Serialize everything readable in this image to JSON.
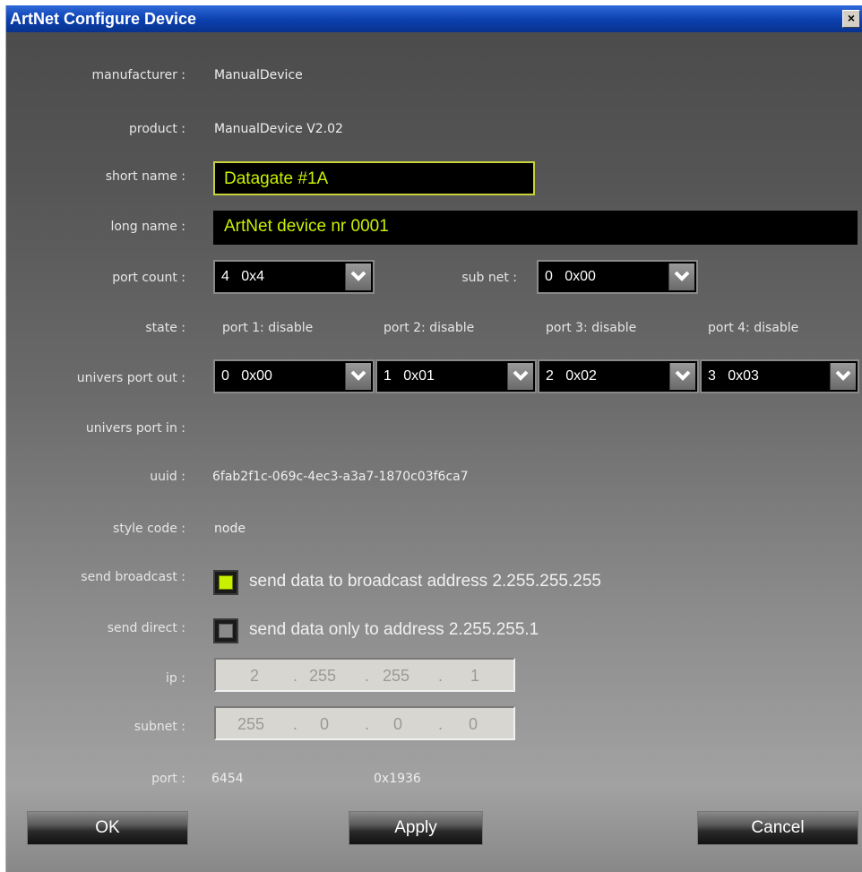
{
  "window": {
    "title": "ArtNet Configure Device",
    "close_label": "×"
  },
  "labels": {
    "manufacturer": "manufacturer :",
    "product": "product :",
    "short_name": "short name :",
    "long_name": "long name :",
    "port_count": "port count :",
    "sub_net": "sub net :",
    "state": "state :",
    "univers_port_out": "univers port out :",
    "univers_port_in": "univers port in :",
    "uuid": "uuid :",
    "style_code": "style code :",
    "send_broadcast": "send broadcast :",
    "send_direct": "send direct :",
    "ip": "ip :",
    "subnet": "subnet :",
    "port": "port :"
  },
  "values": {
    "manufacturer": "ManualDevice",
    "product": "ManualDevice V2.02",
    "short_name": "Datagate #1A",
    "long_name": "ArtNet device nr 0001",
    "port_count": "4   0x4",
    "sub_net": "0   0x00",
    "uuid": "6fab2f1c-069c-4ec3-a3a7-1870c03f6ca7",
    "style_code": "node",
    "port_dec": "6454",
    "port_hex": "0x1936"
  },
  "states": [
    "port 1: disable",
    "port 2: disable",
    "port 3: disable",
    "port 4: disable"
  ],
  "univers_out": [
    "0   0x00",
    "1   0x01",
    "2   0x02",
    "3   0x03"
  ],
  "send_broadcast": {
    "checked": true,
    "label": "send data to broadcast address 2.255.255.255"
  },
  "send_direct": {
    "checked": false,
    "label": "send data only to address 2.255.255.1"
  },
  "ip": [
    "2",
    "255",
    "255",
    "1"
  ],
  "subnet": [
    "255",
    "0",
    "0",
    "0"
  ],
  "ip_separator": ".",
  "buttons": {
    "ok": "OK",
    "apply": "Apply",
    "cancel": "Cancel"
  },
  "colors": {
    "accent": "#c8f000",
    "titlebar": "#0b3fae"
  }
}
